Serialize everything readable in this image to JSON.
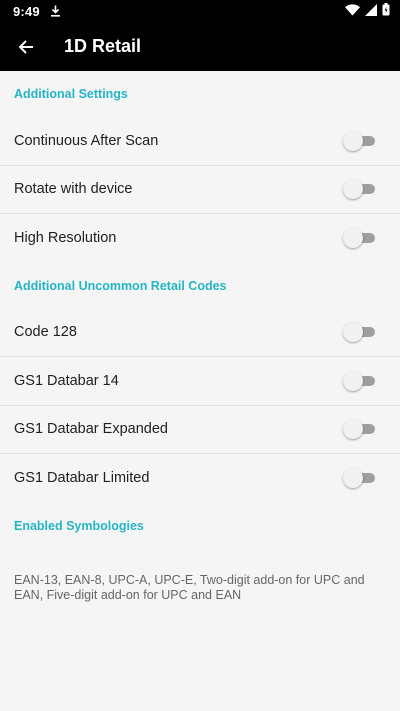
{
  "status_bar": {
    "time": "9:49"
  },
  "app_bar": {
    "title": "1D Retail"
  },
  "sections": [
    {
      "header": "Additional Settings",
      "items": [
        {
          "label": "Continuous After Scan",
          "enabled": false
        },
        {
          "label": "Rotate with device",
          "enabled": false
        },
        {
          "label": "High Resolution",
          "enabled": false
        }
      ]
    },
    {
      "header": "Additional Uncommon Retail Codes",
      "items": [
        {
          "label": "Code 128",
          "enabled": false
        },
        {
          "label": "GS1 Databar 14",
          "enabled": false
        },
        {
          "label": "GS1 Databar Expanded",
          "enabled": false
        },
        {
          "label": "GS1 Databar Limited",
          "enabled": false
        }
      ]
    },
    {
      "header": "Enabled Symbologies",
      "description": "EAN-13, EAN-8, UPC-A, UPC-E, Two-digit add-on for UPC and EAN, Five-digit add-on for UPC and EAN"
    }
  ],
  "colors": {
    "accent": "#26b5c7",
    "app_bar": "#000000",
    "background": "#f5f5f5",
    "switch_track_off": "#9e9e9e",
    "switch_thumb_off": "#f1f1f1"
  },
  "icons": [
    "download-icon",
    "wifi-icon",
    "cellular-signal-icon",
    "battery-icon",
    "back-arrow-icon"
  ]
}
